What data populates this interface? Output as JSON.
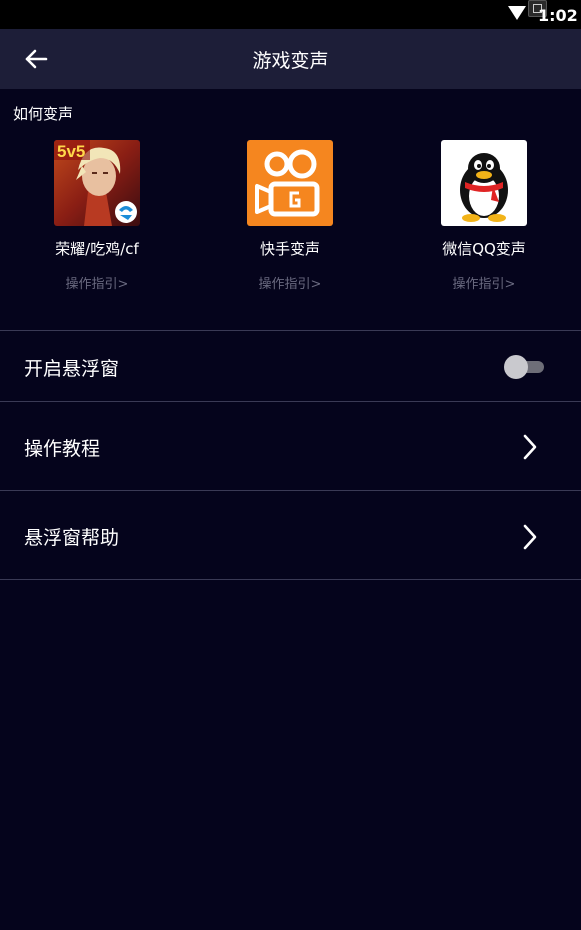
{
  "status_bar": {
    "time": "1:02"
  },
  "app_bar": {
    "title": "游戏变声"
  },
  "how_section": {
    "label": "如何变声",
    "items": [
      {
        "name": "荣耀/吃鸡/cf",
        "guide": "操作指引>",
        "icon": "game-icon"
      },
      {
        "name": "快手变声",
        "guide": "操作指引>",
        "icon": "kuaishou-icon"
      },
      {
        "name": "微信QQ变声",
        "guide": "操作指引>",
        "icon": "qq-penguin-icon"
      }
    ]
  },
  "settings": {
    "floating_window": {
      "label": "开启悬浮窗",
      "enabled": false
    },
    "tutorial": {
      "label": "操作教程"
    },
    "float_help": {
      "label": "悬浮窗帮助"
    }
  },
  "colors": {
    "background": "#05041c",
    "app_bar": "#1d1e38",
    "divider": "#3a3a55",
    "guide_text": "#6a6a80"
  }
}
